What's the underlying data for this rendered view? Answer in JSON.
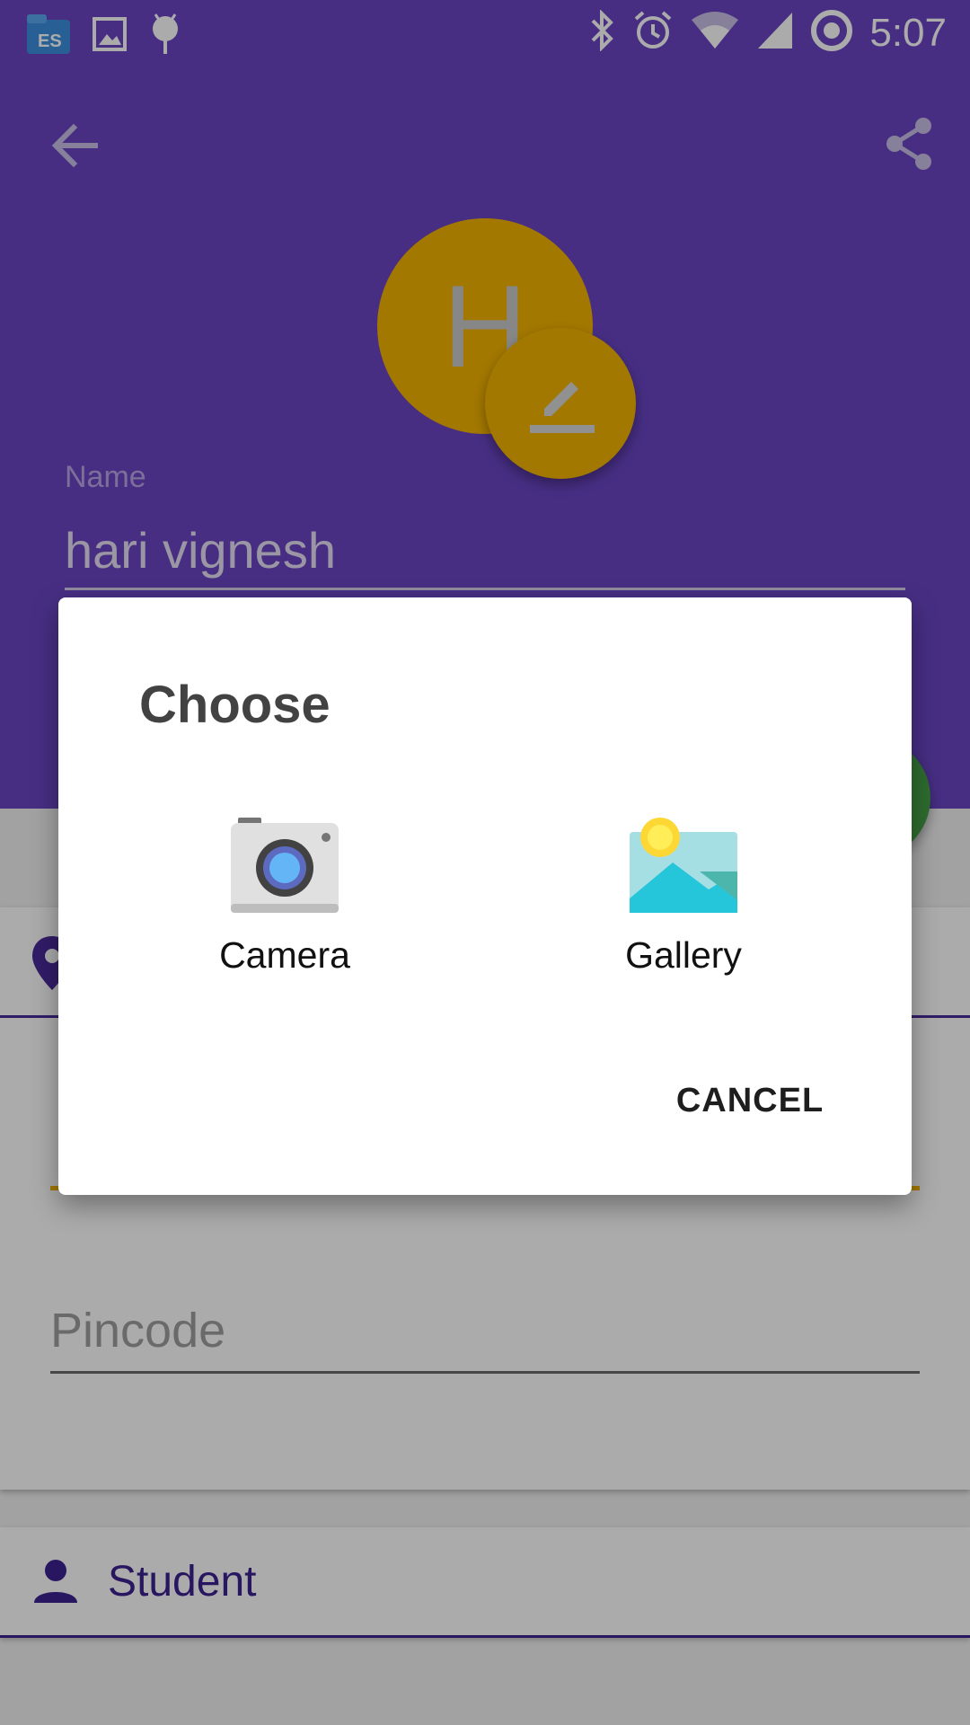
{
  "status_bar": {
    "time": "5:07",
    "left_icons": [
      "file-manager-icon",
      "image-notification-icon",
      "android-debug-icon"
    ],
    "right_icons": [
      "bluetooth-icon",
      "alarm-icon",
      "wifi-icon",
      "signal-icon",
      "sync-icon"
    ]
  },
  "app_bar": {
    "back_icon": "arrow-back-icon",
    "share_icon": "share-icon"
  },
  "profile": {
    "avatar_initial": "H",
    "avatar_color": "#f4b400",
    "edit_icon": "pencil-icon",
    "name_label": "Name",
    "name_value": "hari vignesh"
  },
  "form": {
    "address_icon": "location-pin-icon",
    "pincode_placeholder": "Pincode",
    "role_icon": "person-icon",
    "role_value": "Student"
  },
  "dialog": {
    "title": "Choose",
    "options": [
      {
        "label": "Camera",
        "icon": "camera-icon"
      },
      {
        "label": "Gallery",
        "icon": "gallery-icon"
      }
    ],
    "cancel_label": "CANCEL"
  },
  "colors": {
    "primary": "#6a45c4",
    "primary_dark": "#3d2290",
    "accent": "#f4b400",
    "fab": "#43a047"
  }
}
